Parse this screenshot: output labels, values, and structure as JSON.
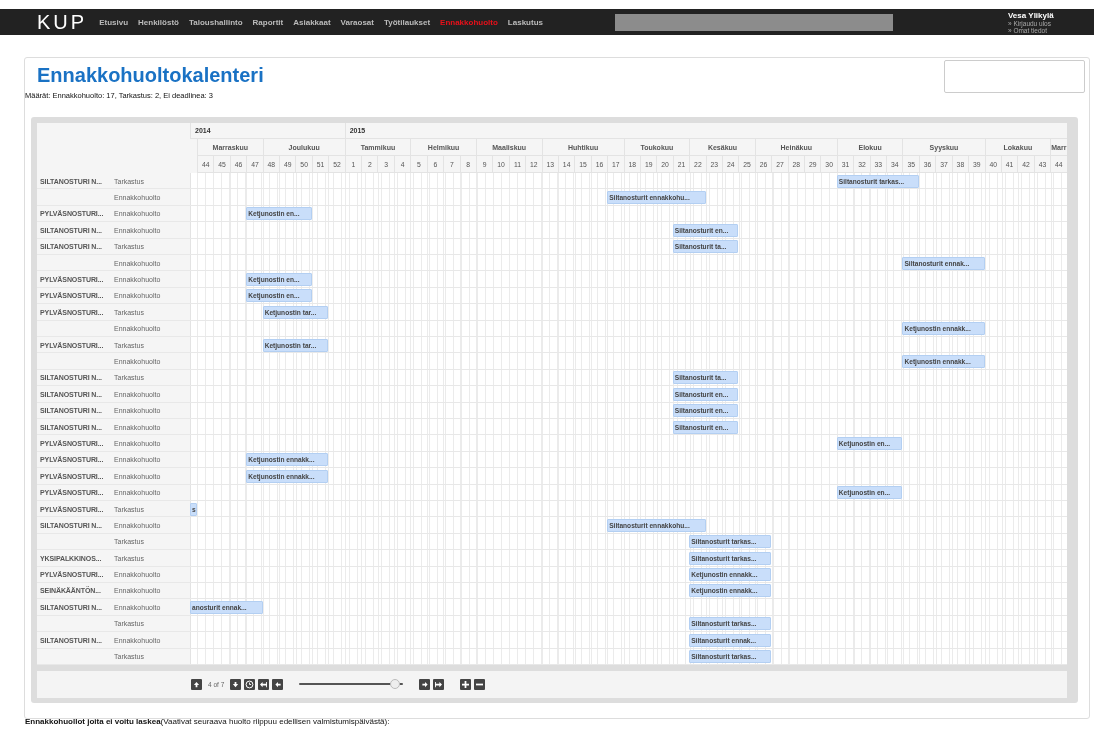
{
  "nav": {
    "logo": "KUP",
    "items": [
      {
        "label": "Etusivu",
        "selected": false
      },
      {
        "label": "Henkilöstö",
        "selected": false
      },
      {
        "label": "Taloushallinto",
        "selected": false
      },
      {
        "label": "Raportit",
        "selected": false
      },
      {
        "label": "Asiakkaat",
        "selected": false
      },
      {
        "label": "Varaosat",
        "selected": false
      },
      {
        "label": "Työtilaukset",
        "selected": false
      },
      {
        "label": "Ennakkohuolto",
        "selected": true
      },
      {
        "label": "Laskutus",
        "selected": false
      }
    ],
    "user": {
      "name": "Vesa Ylikylä",
      "links": [
        "» Kirjaudu ulos",
        "» Omat tiedot"
      ]
    }
  },
  "page": {
    "title": "Ennakkohuoltokalenteri",
    "counts": "Määrät: Ennakkohuolto: 17, Tarkastus: 2, Ei deadlinea: 3"
  },
  "calendar": {
    "years": [
      {
        "label": "2014",
        "months": [
          {
            "label": "Marraskuu",
            "weeks": [
              "44",
              "45",
              "46",
              "47"
            ]
          },
          {
            "label": "Joulukuu",
            "weeks": [
              "48",
              "49",
              "50",
              "51",
              "52"
            ]
          }
        ]
      },
      {
        "label": "2015",
        "months": [
          {
            "label": "Tammikuu",
            "weeks": [
              "1",
              "2",
              "3",
              "4"
            ]
          },
          {
            "label": "Helmikuu",
            "weeks": [
              "5",
              "6",
              "7",
              "8"
            ]
          },
          {
            "label": "Maaliskuu",
            "weeks": [
              "9",
              "10",
              "11",
              "12"
            ]
          },
          {
            "label": "Huhtikuu",
            "weeks": [
              "13",
              "14",
              "15",
              "16",
              "17"
            ]
          },
          {
            "label": "Toukokuu",
            "weeks": [
              "18",
              "19",
              "20",
              "21"
            ]
          },
          {
            "label": "Kesäkuu",
            "weeks": [
              "22",
              "23",
              "24",
              "25"
            ]
          },
          {
            "label": "Heinäkuu",
            "weeks": [
              "26",
              "27",
              "28",
              "29",
              "30"
            ]
          },
          {
            "label": "Elokuu",
            "weeks": [
              "31",
              "32",
              "33",
              "34"
            ]
          },
          {
            "label": "Syyskuu",
            "weeks": [
              "35",
              "36",
              "37",
              "38",
              "39"
            ]
          },
          {
            "label": "Lokakuu",
            "weeks": [
              "40",
              "41",
              "42",
              "43"
            ]
          },
          {
            "label": "Marr",
            "weeks": [
              "44"
            ]
          }
        ]
      }
    ],
    "rows": [
      {
        "name": "SILTANOSTURI N...",
        "type": "Tarkastus",
        "bar": "Siltanosturit tarkas..."
      },
      {
        "type": "Ennakkohuolto",
        "bar": "Siltanosturit ennakkohu..."
      },
      {
        "name": "PYLVÄSNOSTURI...",
        "type": "Ennakkohuolto",
        "bar": "Ketjunostin en..."
      },
      {
        "name": "SILTANOSTURI N...",
        "type": "Ennakkohuolto",
        "bar": "Siltanosturit en..."
      },
      {
        "name": "SILTANOSTURI N...",
        "type": "Tarkastus",
        "bar": "Siltanosturit ta..."
      },
      {
        "type": "Ennakkohuolto",
        "bar": "Siltanosturit ennak..."
      },
      {
        "name": "PYLVÄSNOSTURI...",
        "type": "Ennakkohuolto",
        "bar": "Ketjunostin en..."
      },
      {
        "name": "PYLVÄSNOSTURI...",
        "type": "Ennakkohuolto",
        "bar": "Ketjunostin en..."
      },
      {
        "name": "PYLVÄSNOSTURI...",
        "type": "Tarkastus",
        "bar": "Ketjunostin tar..."
      },
      {
        "type": "Ennakkohuolto",
        "bar": "Ketjunostin ennakk..."
      },
      {
        "name": "PYLVÄSNOSTURI...",
        "type": "Tarkastus",
        "bar": "Ketjunostin tar..."
      },
      {
        "type": "Ennakkohuolto",
        "bar": "Ketjunostin ennakk..."
      },
      {
        "name": "SILTANOSTURI N...",
        "type": "Tarkastus",
        "bar": "Siltanosturit ta..."
      },
      {
        "name": "SILTANOSTURI N...",
        "type": "Ennakkohuolto",
        "bar": "Siltanosturit en..."
      },
      {
        "name": "SILTANOSTURI N...",
        "type": "Ennakkohuolto",
        "bar": "Siltanosturit en..."
      },
      {
        "name": "SILTANOSTURI N...",
        "type": "Ennakkohuolto",
        "bar": "Siltanosturit en..."
      },
      {
        "name": "PYLVÄSNOSTURI...",
        "type": "Ennakkohuolto",
        "bar": "Ketjunostin en..."
      },
      {
        "name": "PYLVÄSNOSTURI...",
        "type": "Ennakkohuolto",
        "bar": "Ketjunostin ennakk..."
      },
      {
        "name": "PYLVÄSNOSTURI...",
        "type": "Ennakkohuolto",
        "bar": "Ketjunostin ennakk..."
      },
      {
        "name": "PYLVÄSNOSTURI...",
        "type": "Ennakkohuolto",
        "bar": "Ketjunostin en..."
      },
      {
        "name": "PYLVÄSNOSTURI...",
        "type": "Tarkastus",
        "bar": "s"
      },
      {
        "name": "SILTANOSTURI N...",
        "type": "Ennakkohuolto",
        "bar": "Siltanosturit ennakkohu..."
      },
      {
        "type": "Tarkastus",
        "bar": "Siltanosturit tarkas..."
      },
      {
        "name": "YKSIPALKKINOS...",
        "type": "Tarkastus",
        "bar": "Siltanosturit tarkas..."
      },
      {
        "name": "PYLVÄSNOSTURI...",
        "type": "Ennakkohuolto",
        "bar": "Ketjunostin ennakk..."
      },
      {
        "name": "SEINÄKÄÄNTÖN...",
        "type": "Ennakkohuolto",
        "bar": "Ketjunostin ennakk..."
      },
      {
        "name": "SILTANOSTURI N...",
        "type": "Ennakkohuolto",
        "bar": "anosturit ennak..."
      },
      {
        "type": "Tarkastus",
        "bar": "Siltanosturit tarkas..."
      },
      {
        "name": "SILTANOSTURI N...",
        "type": "Ennakkohuolto",
        "bar": "Siltanosturit ennak..."
      },
      {
        "type": "Tarkastus",
        "bar": "Siltanosturit tarkas..."
      }
    ],
    "pager": "4 of 7",
    "zoom": {
      "level": 0.92
    }
  },
  "footer": "**Ennakkohuollot joita ei voitu laskea**(Vaativat seuraava huolto riippuu edellisen valmistumispäivästä):"
}
